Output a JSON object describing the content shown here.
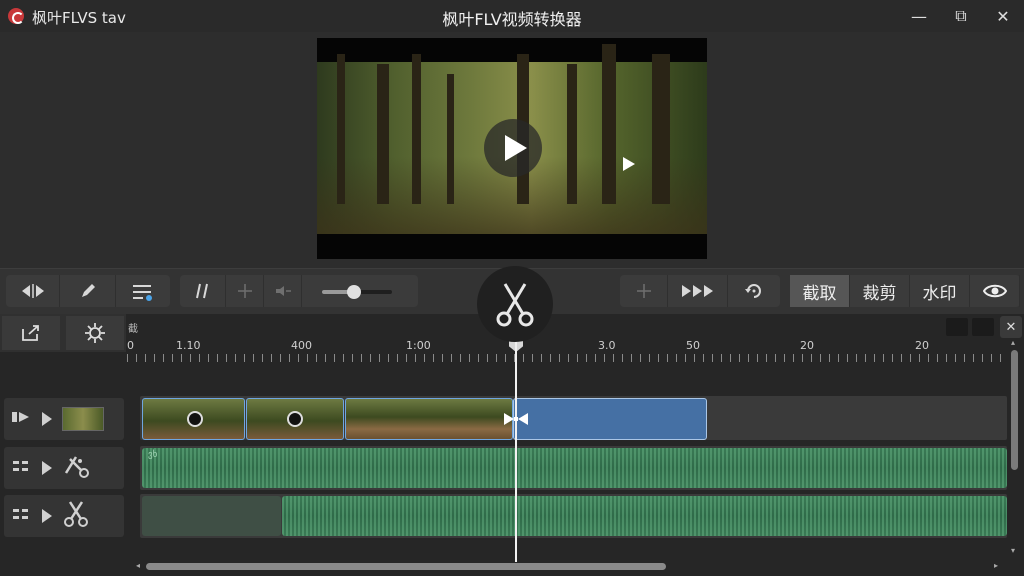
{
  "titlebar": {
    "app_name": "枫叶FLVS  tav",
    "window_title": "枫叶FLV视频转换器",
    "minimize": "—",
    "maximize": "⧉",
    "close": "✕"
  },
  "preview": {
    "play_icon": "play-icon"
  },
  "toolbar": {
    "left_group": [
      "◂▸",
      "pen-icon",
      "adjust-icon"
    ],
    "mid_group": [
      "split-icon",
      "crosshair-icon",
      "speaker-icon"
    ],
    "volume_level": 0.45,
    "right_group": [
      "crosshair-icon",
      "fast-forward-icon",
      "rotate-icon"
    ],
    "modes": [
      "截取",
      "裁剪",
      "水印"
    ],
    "active_mode": "截取",
    "eye_icon": "eye-icon"
  },
  "timeline": {
    "corner_label": "截",
    "ruler_labels": [
      "0",
      "1.10",
      "400",
      "1:00",
      "3.0",
      "50",
      "20",
      "20"
    ],
    "playhead_position": "3.0",
    "tracks": [
      {
        "type": "video",
        "icons": [
          "toggle-icon",
          "play-icon",
          "thumbnail"
        ]
      },
      {
        "type": "audio",
        "icons": [
          "grip-icon",
          "play-icon",
          "effects-scissors-icon"
        ],
        "label": "ვხ"
      },
      {
        "type": "audio",
        "icons": [
          "grip-icon",
          "play-icon",
          "scissors-icon"
        ]
      }
    ]
  },
  "colors": {
    "accent_blue": "#4570a4",
    "audio_green": "#3a7a55",
    "app_logo": "#c8383a"
  }
}
